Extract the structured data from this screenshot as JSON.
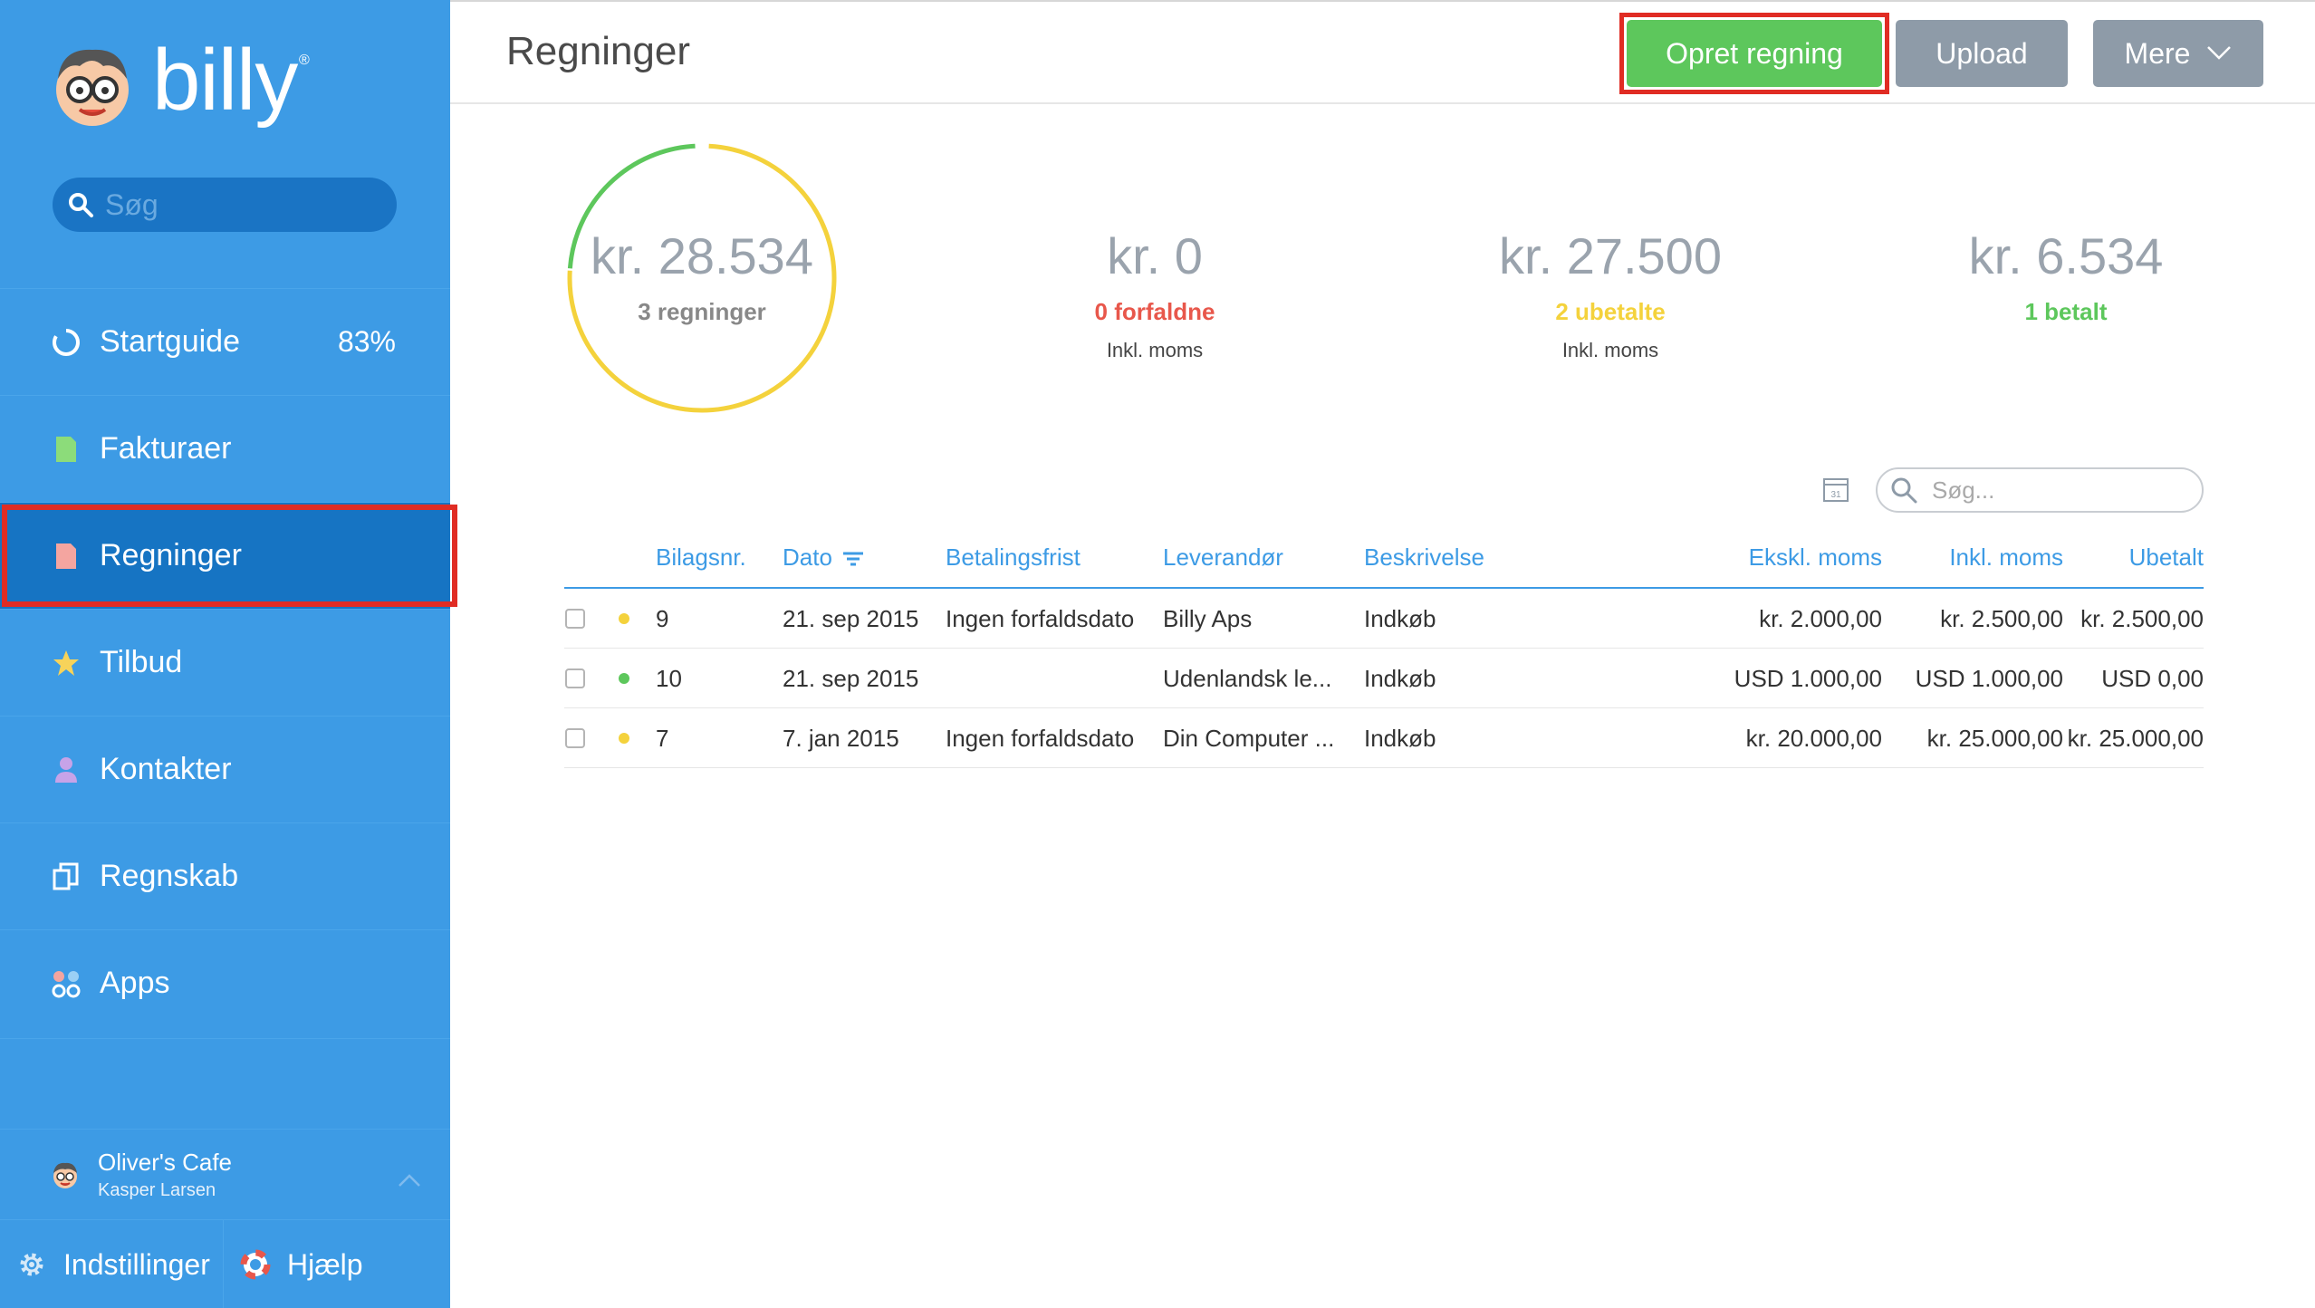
{
  "app": {
    "logo_text": "billy",
    "logo_mark": "®"
  },
  "sidebar": {
    "search_placeholder": "Søg",
    "items": [
      {
        "label": "Startguide",
        "badge": "83%",
        "icon": "progress-ring-icon"
      },
      {
        "label": "Fakturaer",
        "icon": "document-icon"
      },
      {
        "label": "Regninger",
        "icon": "bill-icon",
        "active": true
      },
      {
        "label": "Tilbud",
        "icon": "star-icon"
      },
      {
        "label": "Kontakter",
        "icon": "person-icon"
      },
      {
        "label": "Regnskab",
        "icon": "ledger-icon"
      },
      {
        "label": "Apps",
        "icon": "apps-icon"
      }
    ],
    "organization": {
      "name": "Oliver's Cafe",
      "user": "Kasper Larsen"
    },
    "footer": {
      "settings": "Indstillinger",
      "help": "Hjælp"
    }
  },
  "header": {
    "title": "Regninger",
    "create_button": "Opret regning",
    "upload_button": "Upload",
    "more_button": "Mere"
  },
  "stats": {
    "total": {
      "amount": "kr. 28.534",
      "label": "3 regninger"
    },
    "overdue": {
      "amount": "kr. 0",
      "label": "0 forfaldne",
      "note": "Inkl. moms",
      "color": "#e8574b"
    },
    "unpaid": {
      "amount": "kr. 27.500",
      "label": "2 ubetalte",
      "note": "Inkl. moms",
      "color": "#f4d23c"
    },
    "paid": {
      "amount": "kr. 6.534",
      "label": "1 betalt",
      "color": "#5dc75c"
    },
    "ring_paid_fraction": 0.23
  },
  "table": {
    "search_placeholder": "Søg...",
    "calendar_label": "31",
    "columns": [
      "Bilagsnr.",
      "Dato",
      "Betalingsfrist",
      "Leverandør",
      "Beskrivelse",
      "Ekskl. moms",
      "Inkl. moms",
      "Ubetalt"
    ],
    "rows": [
      {
        "status_color": "#f4d23c",
        "number": "9",
        "date": "21. sep 2015",
        "due": "Ingen forfaldsdato",
        "supplier": "Billy Aps",
        "description": "Indkøb",
        "excl": "kr. 2.000,00",
        "incl": "kr. 2.500,00",
        "unpaid": "kr. 2.500,00"
      },
      {
        "status_color": "#5dc75c",
        "number": "10",
        "date": "21. sep 2015",
        "due": "",
        "supplier": "Udenlandsk le...",
        "description": "Indkøb",
        "excl": "USD 1.000,00",
        "incl": "USD 1.000,00",
        "unpaid": "USD 0,00"
      },
      {
        "status_color": "#f4d23c",
        "number": "7",
        "date": "7. jan 2015",
        "due": "Ingen forfaldsdato",
        "supplier": "Din Computer ...",
        "description": "Indkøb",
        "excl": "kr. 20.000,00",
        "incl": "kr. 25.000,00",
        "unpaid": "kr. 25.000,00"
      }
    ]
  }
}
